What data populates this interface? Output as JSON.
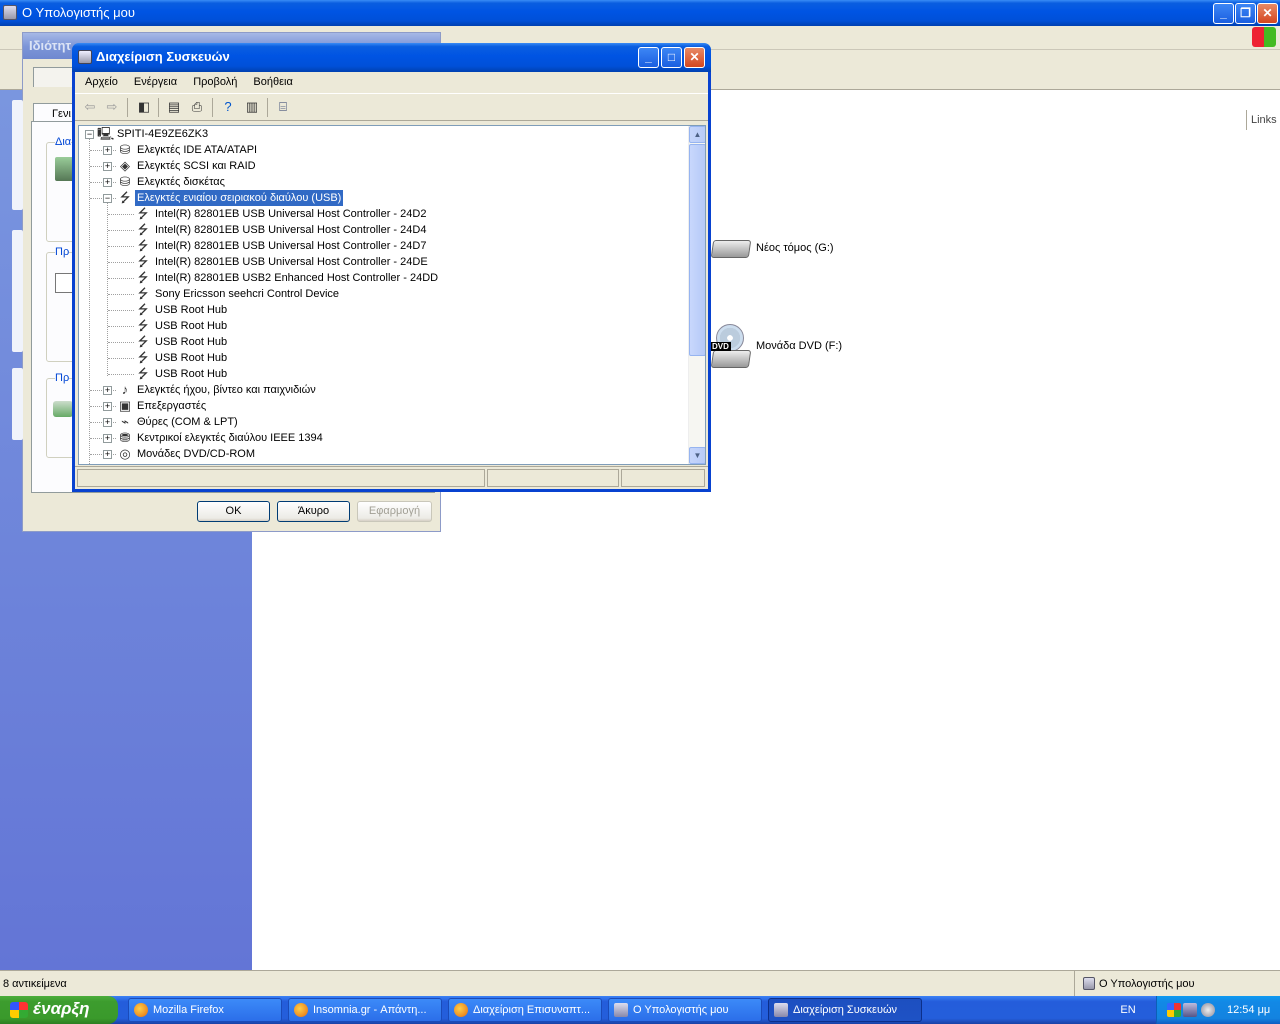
{
  "explorer": {
    "title": "Ο Υπολογιστής μου",
    "links": "Links",
    "status_left": "8 αντικείμενα",
    "status_right": "Ο Υπολογιστής μου",
    "drives": [
      {
        "label": "Νέος τόμος (G:)",
        "icon": "hard-drive-icon"
      },
      {
        "label": "Μονάδα DVD (F:)",
        "icon": "dvd-drive-icon",
        "badge": "DVD"
      }
    ]
  },
  "props_dialog": {
    "title": "Ιδιότητ",
    "tab": "Γενι",
    "group_labels": [
      "Δια",
      "Πρ",
      "Πρ"
    ],
    "ok": "OK",
    "cancel": "Άκυρο",
    "apply": "Εφαρμογή"
  },
  "devmgr": {
    "title": "Διαχείριση Συσκευών",
    "menu": [
      "Αρχείο",
      "Ενέργεια",
      "Προβολή",
      "Βοήθεια"
    ],
    "root": "SPITI-4E9ZE6ZK3",
    "categories_before": [
      {
        "label": "Ελεγκτές IDE ATA/ATAPI",
        "icon": "ide-controller-icon"
      },
      {
        "label": "Ελεγκτές SCSI και RAID",
        "icon": "scsi-controller-icon"
      },
      {
        "label": "Ελεγκτές δισκέτας",
        "icon": "floppy-controller-icon"
      }
    ],
    "selected_category": "Ελεγκτές ενιαίου σειριακού διαύλου (USB)",
    "usb_devices": [
      "Intel(R) 82801EB USB Universal Host Controller - 24D2",
      "Intel(R) 82801EB USB Universal Host Controller - 24D4",
      "Intel(R) 82801EB USB Universal Host Controller - 24D7",
      "Intel(R) 82801EB USB Universal Host Controller - 24DE",
      "Intel(R) 82801EB USB2 Enhanced Host Controller - 24DD",
      "Sony Ericsson seehcri Control Device",
      "USB Root Hub",
      "USB Root Hub",
      "USB Root Hub",
      "USB Root Hub",
      "USB Root Hub"
    ],
    "categories_after": [
      {
        "label": "Ελεγκτές ήχου, βίντεο και παιχνιδιών",
        "icon": "sound-controller-icon"
      },
      {
        "label": "Επεξεργαστές",
        "icon": "processor-icon"
      },
      {
        "label": "Θύρες (COM & LPT)",
        "icon": "port-icon"
      },
      {
        "label": "Κεντρικοί ελεγκτές διαύλου IEEE 1394",
        "icon": "ieee1394-icon"
      },
      {
        "label": "Μονάδες DVD/CD-ROM",
        "icon": "dvd-rom-icon"
      }
    ]
  },
  "taskbar": {
    "start": "έναρξη",
    "tasks": [
      {
        "label": "Mozilla Firefox",
        "icon": "firefox-icon"
      },
      {
        "label": "Insomnia.gr - Απάντη...",
        "icon": "firefox-icon"
      },
      {
        "label": "Διαχείριση Επισυναπτ...",
        "icon": "firefox-icon"
      },
      {
        "label": "Ο Υπολογιστής μου",
        "icon": "computer-icon"
      },
      {
        "label": "Διαχείριση Συσκευών",
        "icon": "device-manager-icon"
      }
    ],
    "lang": "EN",
    "clock": "12:54 μμ"
  }
}
